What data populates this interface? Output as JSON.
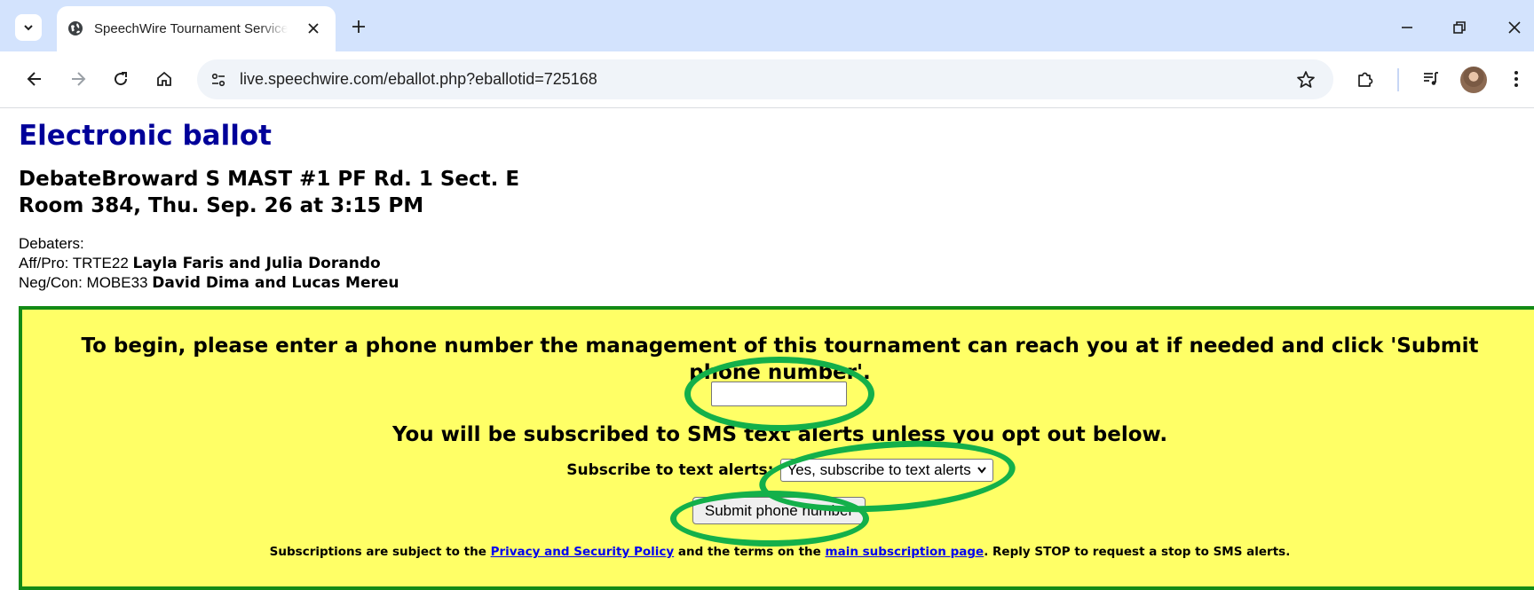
{
  "browser": {
    "tab_title": "SpeechWire Tournament Services",
    "url": "live.speechwire.com/eballot.php?eballotid=725168"
  },
  "page": {
    "title": "Electronic ballot",
    "round_line1": "DebateBroward S MAST #1 PF Rd. 1 Sect. E",
    "round_line2": "Room 384, Thu. Sep. 26 at 3:15 PM",
    "debaters_label": "Debaters:",
    "aff_prefix": "Aff/Pro: TRTE22",
    "aff_names": "Layla Faris and Julia Dorando",
    "neg_prefix": "Neg/Con: MOBE33",
    "neg_names": "David Dima and Lucas Mereu"
  },
  "form": {
    "instruction": "To begin, please enter a phone number the management of this tournament can reach you at if needed and click 'Submit phone number'.",
    "phone_value": "",
    "sms_note": "You will be subscribed to SMS text alerts unless you opt out below.",
    "subscribe_label": "Subscribe to text alerts:",
    "subscribe_selected": "Yes, subscribe to text alerts",
    "submit_label": "Submit phone number",
    "fine_print_1": "Subscriptions are subject to the",
    "privacy_link": "Privacy and Security Policy",
    "fine_print_2": "and the terms on the",
    "subscription_link": "main subscription page",
    "fine_print_3": ". Reply STOP to request a stop to SMS alerts."
  },
  "colors": {
    "title": "#000099",
    "box_background": "#ffff66",
    "box_border": "#138a16",
    "annotation": "#13b04a"
  }
}
